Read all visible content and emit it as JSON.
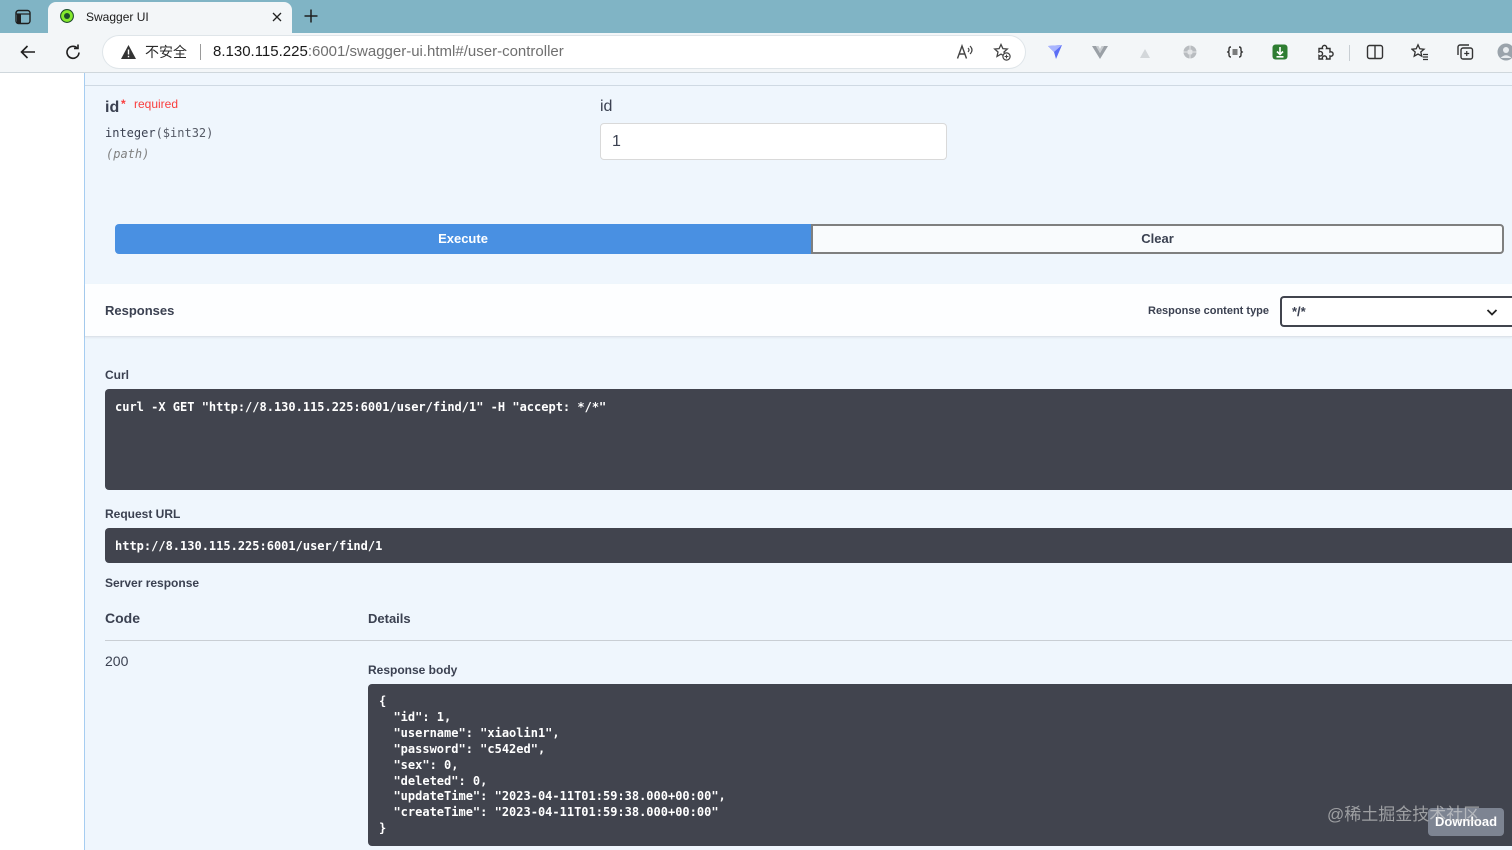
{
  "browser": {
    "tab": {
      "title": "Swagger UI"
    },
    "address_bar": {
      "security_label": "不安全",
      "url_host": "8.130.115.225",
      "url_path": ":6001/swagger-ui.html#/user-controller"
    }
  },
  "icons": {
    "tab_strip": [
      "tab-actions-icon",
      "swagger-favicon-icon",
      "close-icon",
      "plus-icon"
    ],
    "toolbar": [
      "back-arrow-icon",
      "refresh-icon",
      "warning-icon",
      "read-aloud-icon",
      "add-favorite-icon"
    ],
    "extensions": [
      "kite-extension-icon",
      "vue-devtools-icon",
      "triangle-extension-icon",
      "circle-extension-icon",
      "json-formatter-icon",
      "download-manager-icon",
      "extensions-puzzle-icon",
      "split-screen-icon",
      "favorites-icon",
      "collections-icon",
      "profile-avatar-icon"
    ],
    "select": "chevron-down-icon"
  },
  "parameter": {
    "name": "id",
    "required_marker": "*",
    "required_label": "required",
    "type": "integer",
    "format": "($int32)",
    "location": "(path)",
    "description": "id",
    "value": "1"
  },
  "actions": {
    "execute_label": "Execute",
    "clear_label": "Clear"
  },
  "responses": {
    "title": "Responses",
    "content_type_label": "Response content type",
    "content_type_value": "*/*"
  },
  "curl": {
    "label": "Curl",
    "command": "curl -X GET \"http://8.130.115.225:6001/user/find/1\" -H \"accept: */*\""
  },
  "request_url": {
    "label": "Request URL",
    "value": "http://8.130.115.225:6001/user/find/1"
  },
  "server_response": {
    "label": "Server response",
    "columns": {
      "code": "Code",
      "details": "Details"
    },
    "code": "200",
    "body_label": "Response body",
    "body": "{\n  \"id\": 1,\n  \"username\": \"xiaolin1\",\n  \"password\": \"c542ed\",\n  \"sex\": 0,\n  \"deleted\": 0,\n  \"updateTime\": \"2023-04-11T01:59:38.000+00:00\",\n  \"createTime\": \"2023-04-11T01:59:38.000+00:00\"\n}",
    "download_label": "Download"
  },
  "watermark": "@稀土掘金技术社区",
  "colors": {
    "tab_strip": "#80b4c5",
    "get_operation_background": "#eff6fd",
    "execute_button": "#4990e2",
    "code_block": "#41444e",
    "required": "#f93e3e",
    "download_button": "#7d8492"
  }
}
